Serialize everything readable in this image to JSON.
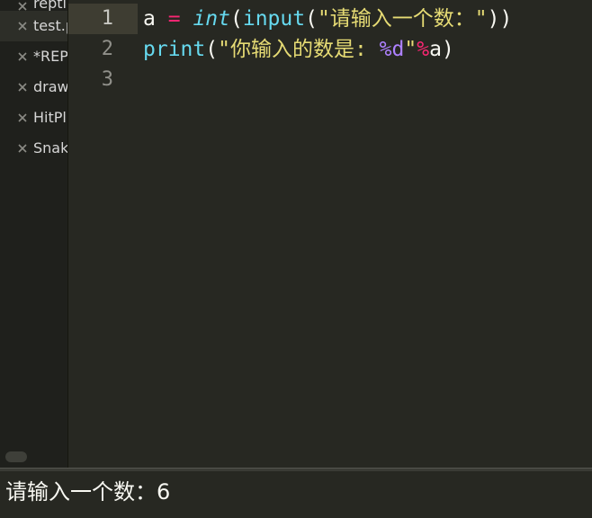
{
  "sidebar": {
    "items": [
      {
        "label": "repti",
        "active": false
      },
      {
        "label": "test.p",
        "active": true
      },
      {
        "label": "*REP",
        "active": false
      },
      {
        "label": "draw",
        "active": false
      },
      {
        "label": "HitPl",
        "active": false
      },
      {
        "label": "Snak",
        "active": false
      }
    ]
  },
  "editor": {
    "line_numbers": [
      "1",
      "2",
      "3"
    ],
    "line1": {
      "var": "a",
      "sp1": " ",
      "eq": "=",
      "sp2": " ",
      "int": "int",
      "p1": "(",
      "input": "input",
      "p2": "(",
      "str": "\"请输入一个数：\"",
      "p3": "))"
    },
    "line2": {
      "print": "print",
      "p1": "(",
      "str_a": "\"你输入的数是: ",
      "fmt": "%d",
      "str_b": "\"",
      "mod": "%",
      "var": "a",
      "p2": ")"
    },
    "line3": ""
  },
  "console": {
    "output": "请输入一个数：6"
  },
  "colors": {
    "background": "#272822",
    "sidebar_bg": "#1f201c",
    "keyword_pink": "#f92672",
    "builtin_cyan": "#66d9ef",
    "string_yellow": "#e6db74",
    "format_purple": "#ae81ff",
    "text": "#f8f8f2"
  }
}
